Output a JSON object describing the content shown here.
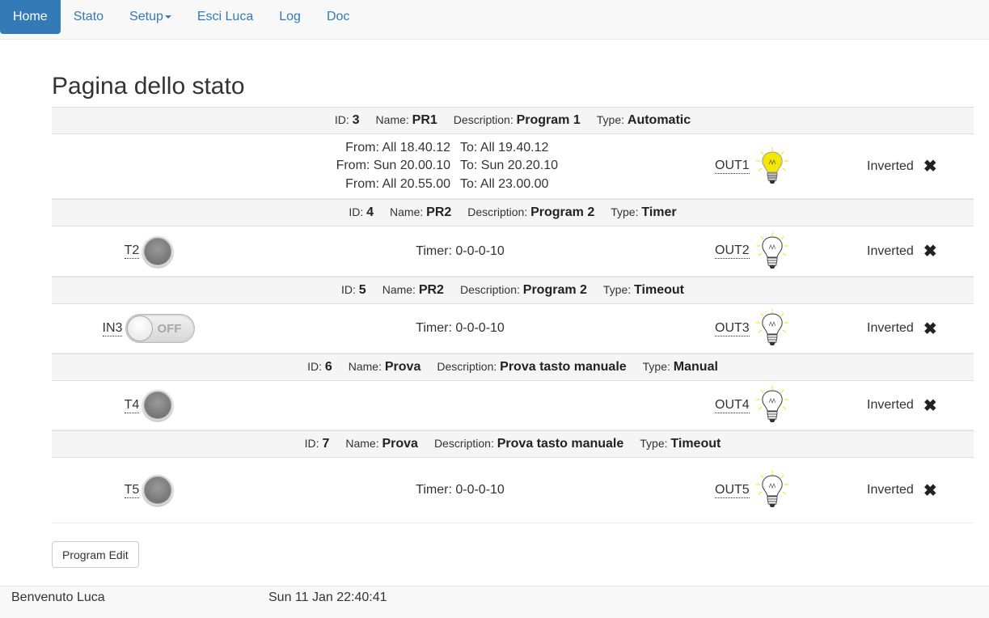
{
  "nav": {
    "items": [
      {
        "label": "Home",
        "active": true
      },
      {
        "label": "Stato"
      },
      {
        "label": "Setup",
        "dropdown": true
      },
      {
        "label": "Esci Luca"
      },
      {
        "label": "Log"
      },
      {
        "label": "Doc"
      }
    ]
  },
  "page_title": "Pagina dello stato",
  "field_labels": {
    "id": "ID:",
    "name": "Name:",
    "description": "Description:",
    "type": "Type:"
  },
  "programs": [
    {
      "id": "3",
      "name": "PR1",
      "description": "Program 1",
      "type": "Automatic",
      "input": null,
      "schedule": [
        {
          "from": "From: All 18.40.12",
          "to": "To: All 19.40.12"
        },
        {
          "from": "From: Sun 20.00.10",
          "to": "To: Sun 20.20.10"
        },
        {
          "from": "From: All 20.55.00",
          "to": "To: All 23.00.00"
        }
      ],
      "timer": null,
      "output": "OUT1",
      "output_on": true,
      "inverted": "Inverted"
    },
    {
      "id": "4",
      "name": "PR2",
      "description": "Program 2",
      "type": "Timer",
      "input": {
        "label": "T2",
        "kind": "knob"
      },
      "timer": "Timer: 0-0-0-10",
      "output": "OUT2",
      "output_on": false,
      "inverted": "Inverted"
    },
    {
      "id": "5",
      "name": "PR2",
      "description": "Program 2",
      "type": "Timeout",
      "input": {
        "label": "IN3",
        "kind": "toggle",
        "state_text": "OFF"
      },
      "timer": "Timer: 0-0-0-10",
      "output": "OUT3",
      "output_on": false,
      "inverted": "Inverted"
    },
    {
      "id": "6",
      "name": "Prova",
      "description": "Prova tasto manuale",
      "type": "Manual",
      "input": {
        "label": "T4",
        "kind": "knob"
      },
      "timer": null,
      "output": "OUT4",
      "output_on": false,
      "inverted": "Inverted"
    },
    {
      "id": "7",
      "name": "Prova",
      "description": "Prova tasto manuale",
      "type": "Timeout",
      "input": {
        "label": "T5",
        "kind": "knob"
      },
      "timer": "Timer: 0-0-0-10",
      "output": "OUT5",
      "output_on": false,
      "inverted": "Inverted"
    }
  ],
  "icons": {
    "bulb_on": "lightbulb-on-icon",
    "bulb_off": "lightbulb-off-icon",
    "remove": "close-icon",
    "caret": "caret-down-icon"
  },
  "colors": {
    "accent": "#337ab7",
    "bulb_on": "#f5e800"
  },
  "program_edit_label": "Program Edit",
  "footer": {
    "welcome": "Benvenuto Luca",
    "clock": "Sun 11 Jan 22:40:41"
  }
}
